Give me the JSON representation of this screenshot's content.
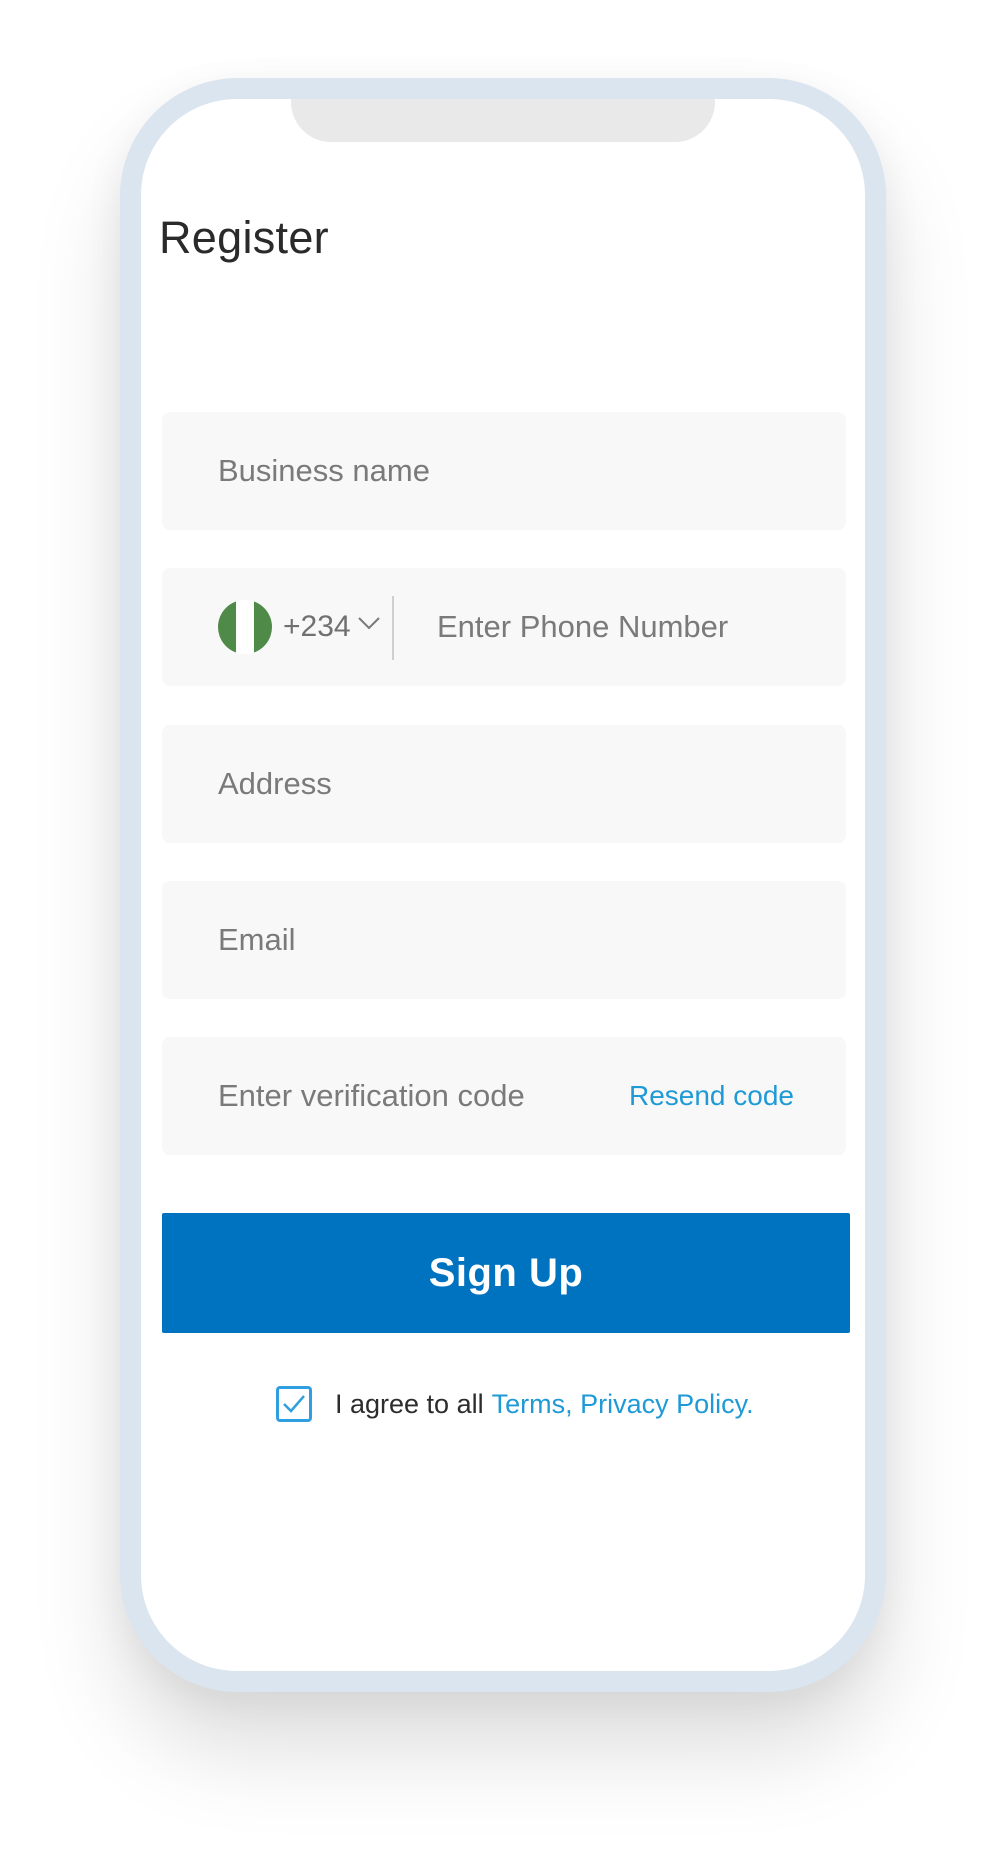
{
  "page": {
    "title": "Register"
  },
  "form": {
    "business_name_placeholder": "Business name",
    "phone": {
      "country": "nigeria-flag",
      "dial_code": "+234",
      "placeholder": "Enter Phone Number"
    },
    "address_placeholder": "Address",
    "email_placeholder": "Email",
    "verification_placeholder": "Enter verification code",
    "resend_label": "Resend code",
    "submit_label": "Sign Up"
  },
  "agreement": {
    "checked": true,
    "text": "I agree to all",
    "link_text": "Terms, Privacy Policy."
  },
  "colors": {
    "primary": "#0073c0",
    "link": "#1f9ad6",
    "field_bg": "#f8f8f8",
    "frame": "#dbe5ef",
    "flag_green": "#4f8a48"
  }
}
